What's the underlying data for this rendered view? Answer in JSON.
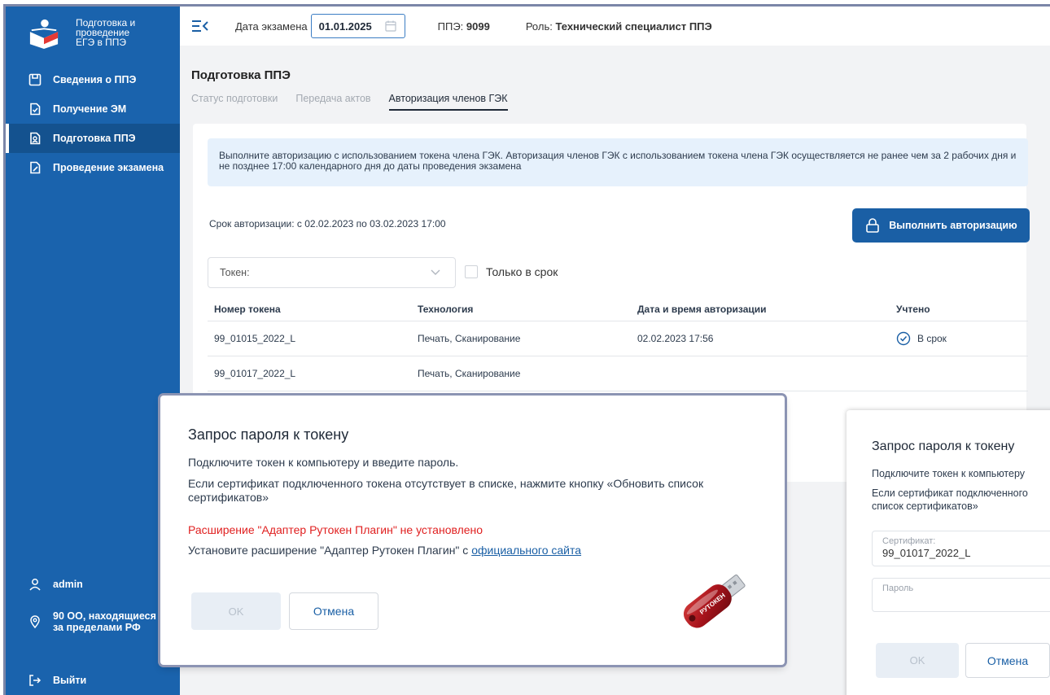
{
  "sidebar": {
    "logo_text": "Подготовка и проведение ЕГЭ в ППЭ",
    "items": [
      {
        "label": "Сведения о ППЭ",
        "icon": "save-icon"
      },
      {
        "label": "Получение ЭМ",
        "icon": "document-check-icon"
      },
      {
        "label": "Подготовка ППЭ",
        "icon": "document-user-icon"
      },
      {
        "label": "Проведение экзамена",
        "icon": "document-pen-icon"
      }
    ],
    "user": "admin",
    "location": "90 ОО, находящиеся за пределами РФ",
    "logout": "Выйти"
  },
  "header": {
    "date_label": "Дата экзамена",
    "date_value": "01.01.2025",
    "ppe_label": "ППЭ: ",
    "ppe_value": "9099",
    "role_label": "Роль: ",
    "role_value": "Технический специалист ППЭ"
  },
  "page": {
    "title": "Подготовка ППЭ",
    "tabs": [
      "Статус подготовки",
      "Передача актов",
      "Авторизация членов ГЭК"
    ],
    "info": "Выполните авторизацию с использованием токена члена ГЭК. Авторизация членов ГЭК с использованием токена члена ГЭК осуществляется не ранее чем за 2 рабочих дня и не позднее 17:00 календарного дня до даты проведения экзамена",
    "deadline": "Срок авторизации: с 02.02.2023 по 03.02.2023 17:00",
    "auth_button": "Выполнить авторизацию",
    "token_select": "Токен:",
    "only_in_time": "Только в срок",
    "columns": [
      "Номер токена",
      "Технология",
      "Дата и время авторизации",
      "Учтено"
    ],
    "rows": [
      [
        "99_01015_2022_L",
        "Печать, Сканирование",
        "02.02.2023 17:56",
        "В срок"
      ],
      [
        "99_01017_2022_L",
        "Печать, Сканирование",
        "",
        ""
      ]
    ]
  },
  "dialog1": {
    "title": "Запрос пароля к токену",
    "line1": "Подключите токен к компьютеру и введите пароль.",
    "line2": "Если сертификат подключенного токена отсутствует в списке, нажмите кнопку «Обновить список сертификатов»",
    "error": "Расширение \"Адаптер Рутокен Плагин\" не установлено",
    "install_text": "Установите расширение \"Адаптер Рутокен Плагин\" с ",
    "install_link": "официального сайта",
    "ok": "OK",
    "cancel": "Отмена",
    "token_brand": "РУТОКЕН"
  },
  "dialog2": {
    "title": "Запрос пароля к токену",
    "line1": "Подключите токен к компьютеру",
    "line2a": "Если сертификат подключенного",
    "line2b": "список сертификатов»",
    "cert_label": "Сертификат:",
    "cert_value": "99_01017_2022_L",
    "password_label": "Пароль",
    "ok": "OK",
    "cancel": "Отмена"
  },
  "colors": {
    "sidebar": "#1a63ad",
    "primary": "#1a5fa5",
    "error": "#e02020",
    "info_bg": "#e6f1fc"
  }
}
